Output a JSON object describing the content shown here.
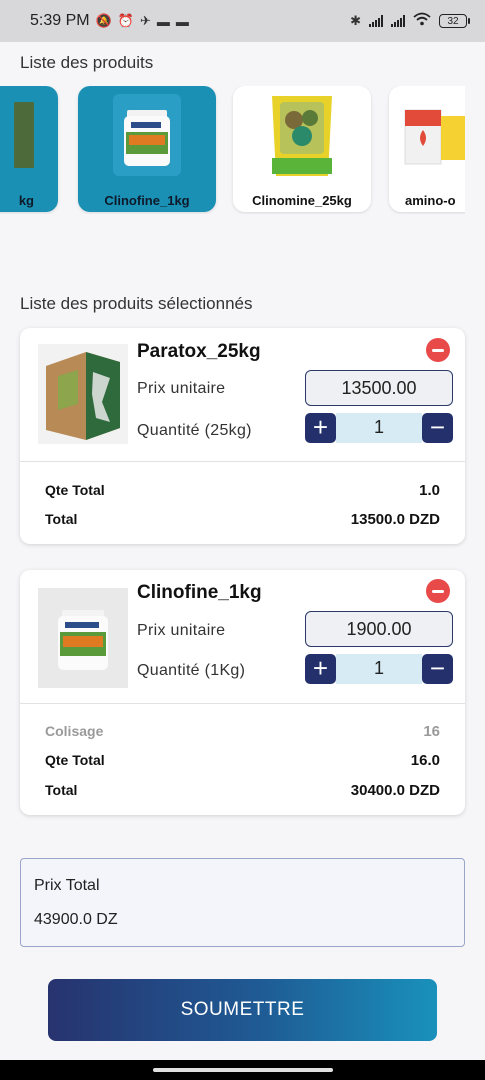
{
  "status_bar": {
    "time": "5:39 PM",
    "battery": "32",
    "icons": [
      "mute-icon",
      "alarm-icon",
      "telegram-icon",
      "notification-icon",
      "notification-icon",
      "bluetooth-icon",
      "signal-icon",
      "signal-icon",
      "wifi-icon",
      "battery-icon"
    ]
  },
  "products_section": {
    "title": "Liste des produits",
    "items": [
      {
        "name": "kg",
        "selected": true
      },
      {
        "name": "Clinofine_1kg",
        "selected": true
      },
      {
        "name": "Clinomine_25kg",
        "selected": false
      },
      {
        "name": "amino-o",
        "selected": false
      }
    ]
  },
  "selected_section": {
    "title": "Liste des produits sélectionnés",
    "items": [
      {
        "name": "Paratox_25kg",
        "price_label": "Prix unitaire",
        "price": "13500.00",
        "qty_label": "Quantité (25kg)",
        "qty": "1",
        "plus": "+",
        "minus": "−",
        "summary": [
          {
            "label": "Qte Total",
            "value": "1.0",
            "muted": false
          },
          {
            "label": "Total",
            "value": "13500.0 DZD",
            "muted": false
          }
        ]
      },
      {
        "name": "Clinofine_1kg",
        "price_label": "Prix unitaire",
        "price": "1900.00",
        "qty_label": "Quantité (1Kg)",
        "qty": "1",
        "plus": "+",
        "minus": "−",
        "summary": [
          {
            "label": "Colisage",
            "value": "16",
            "muted": true
          },
          {
            "label": "Qte Total",
            "value": "16.0",
            "muted": false
          },
          {
            "label": "Total",
            "value": "30400.0 DZD",
            "muted": false
          }
        ]
      }
    ]
  },
  "total": {
    "label": "Prix Total",
    "value": "43900.0 DZ"
  },
  "submit_label": "SOUMETTRE",
  "colors": {
    "accent": "#1a90b5",
    "navy": "#23306b",
    "remove": "#e84a4a"
  }
}
